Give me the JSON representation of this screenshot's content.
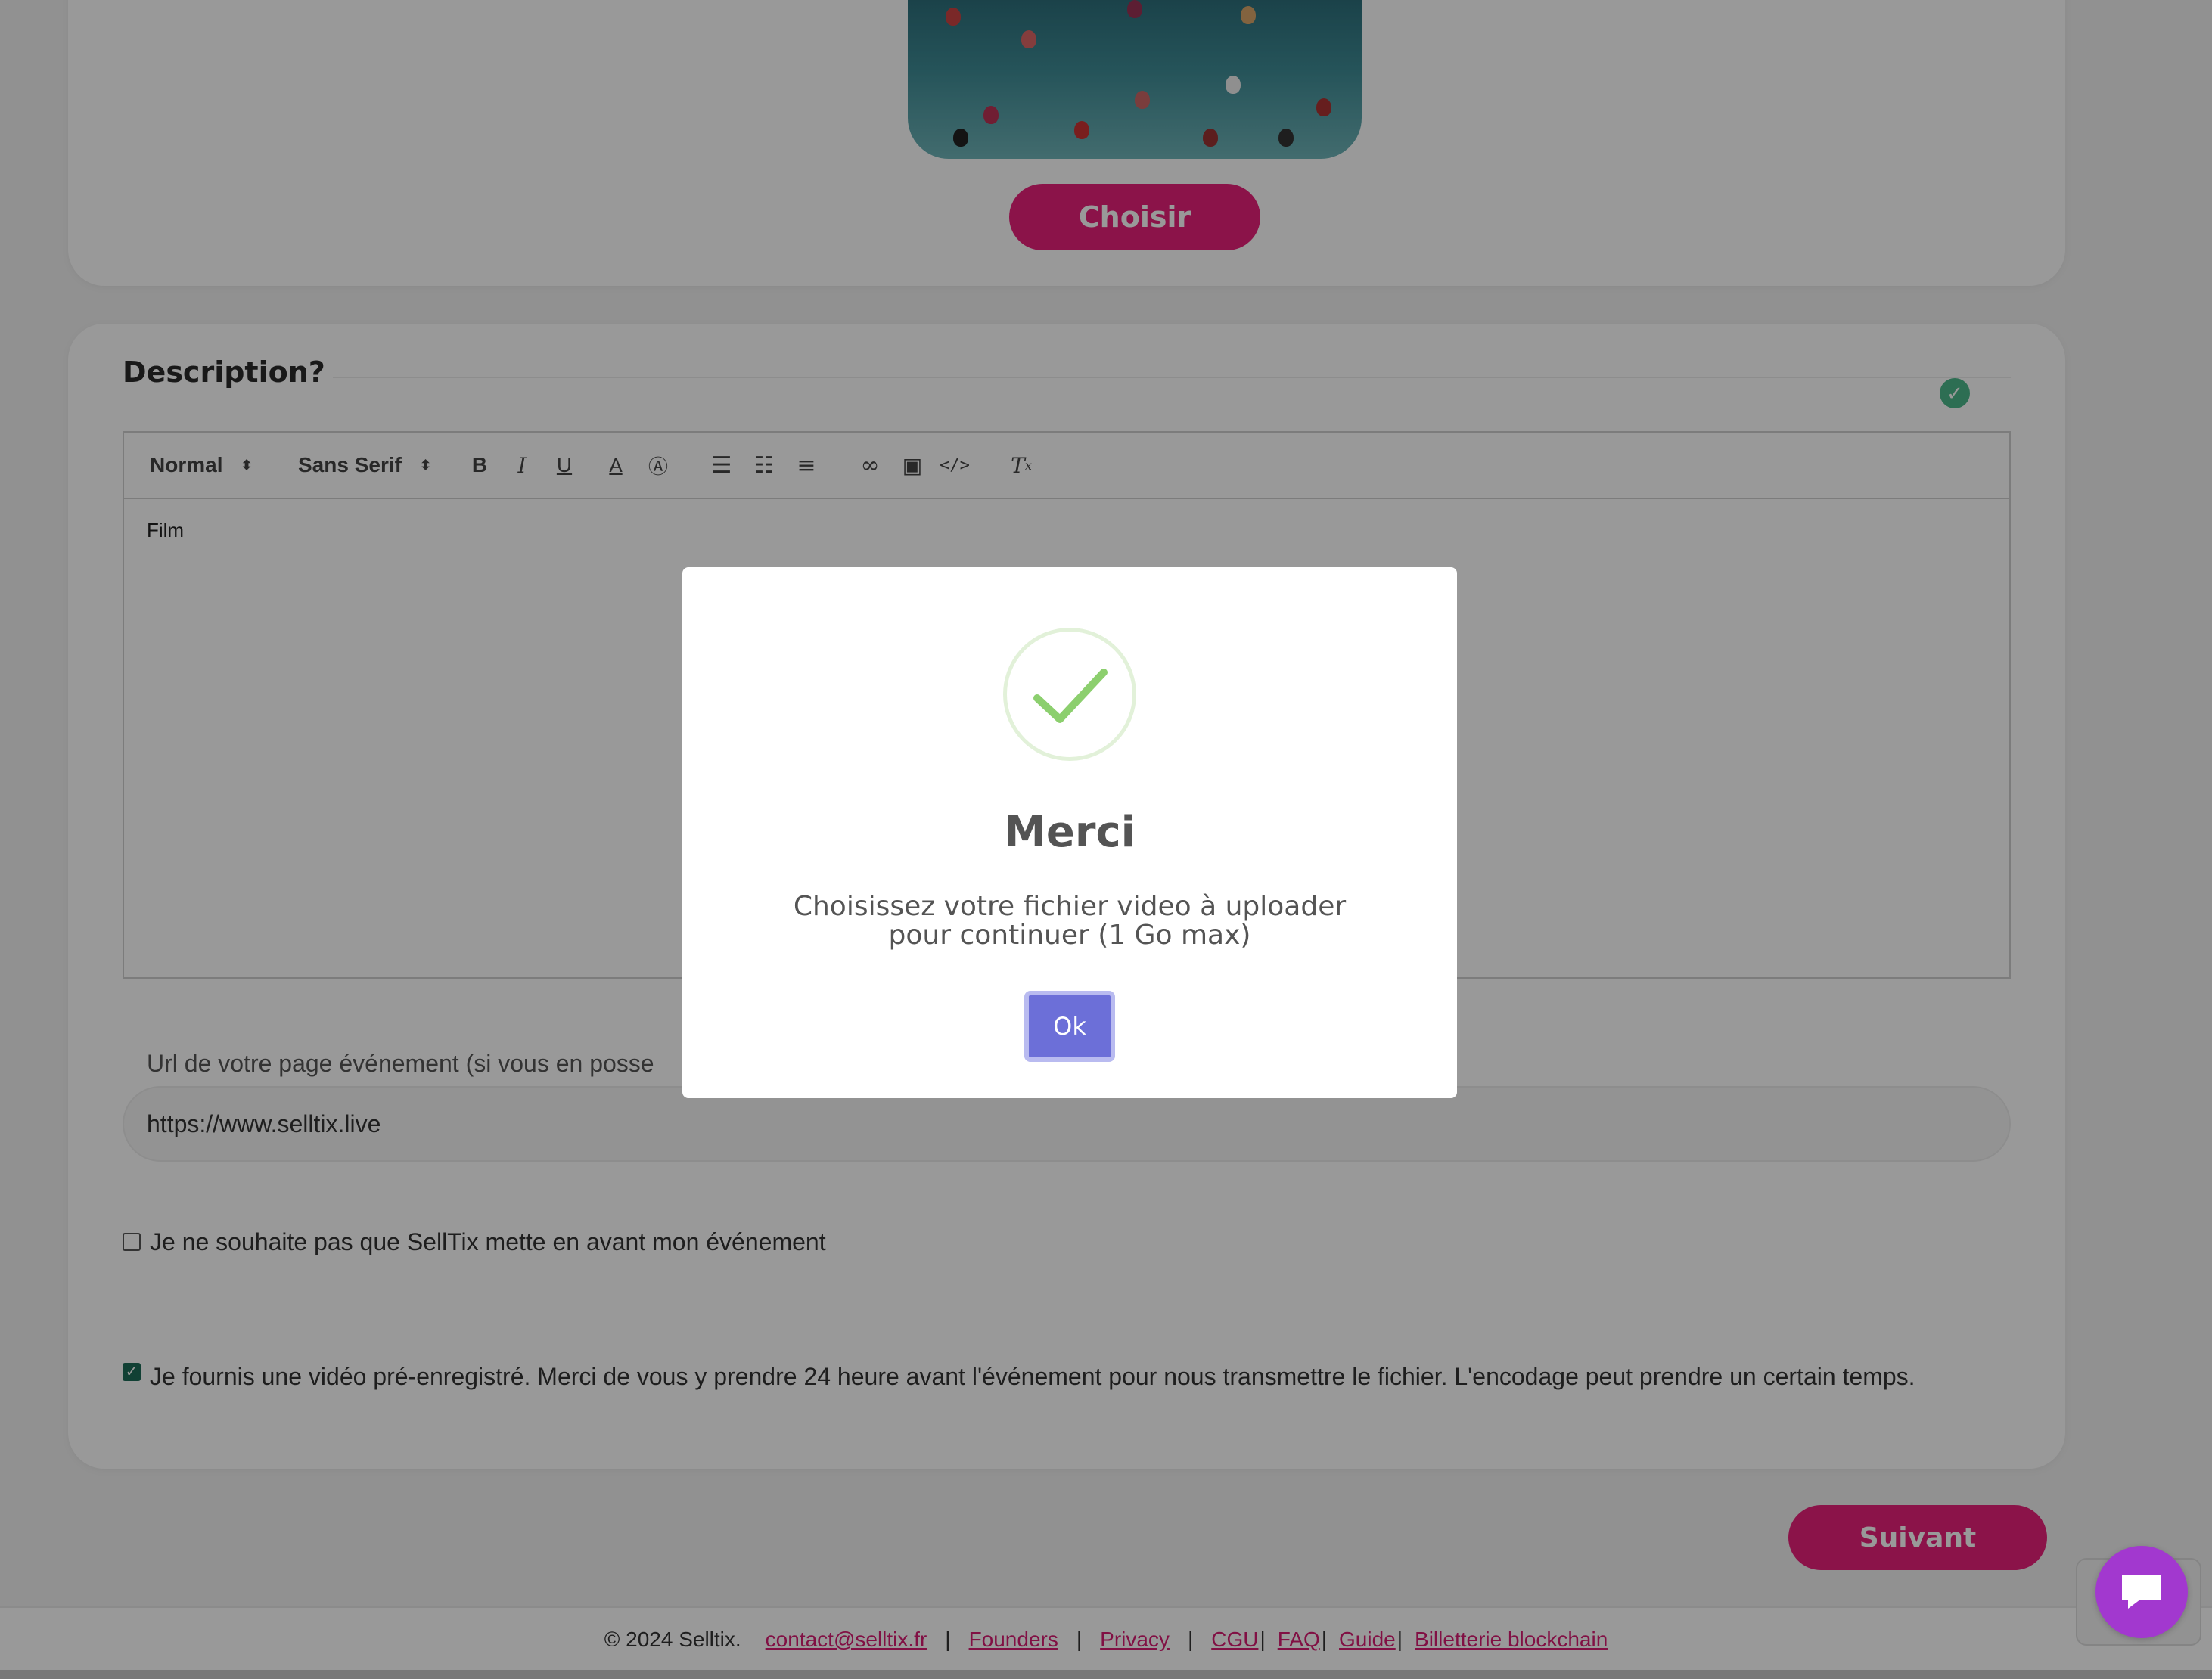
{
  "image_section": {
    "choose_button": "Choisir"
  },
  "description": {
    "title": "Description?",
    "editor": {
      "format_select": "Normal",
      "font_select": "Sans Serif",
      "tools": [
        "bold",
        "italic",
        "underline",
        "text-color",
        "background-color",
        "ordered-list",
        "bullet-list",
        "align",
        "link",
        "image",
        "code",
        "clear-format"
      ],
      "content": "Film"
    },
    "url_label": "Url de votre page événement (si vous en posse",
    "url_value": "https://www.selltix.live",
    "checkbox_no_promote": {
      "checked": false,
      "label": "Je ne souhaite pas que SellTix mette en avant mon événement"
    },
    "checkbox_video": {
      "checked": true,
      "label": "Je fournis une vidéo pré-enregistré. Merci de vous y prendre 24 heure avant l'événement pour nous transmettre le fichier. L'encodage peut prendre un certain temps."
    }
  },
  "next_button": "Suivant",
  "footer": {
    "copyright": "© 2024 Selltix.",
    "email": "contact@selltix.fr",
    "links": [
      "Founders",
      "Privacy",
      "CGU",
      "FAQ",
      "Guide",
      "Billetterie blockchain"
    ]
  },
  "modal": {
    "title": "Merci",
    "text": "Choisissez votre fichier video à uploader pour continuer (1 Go max)",
    "ok_button": "Ok"
  },
  "colors": {
    "brand": "#e8207a",
    "modal_button": "#6c6fd8",
    "success": "#8ccf6e",
    "chat": "#a238cf"
  }
}
